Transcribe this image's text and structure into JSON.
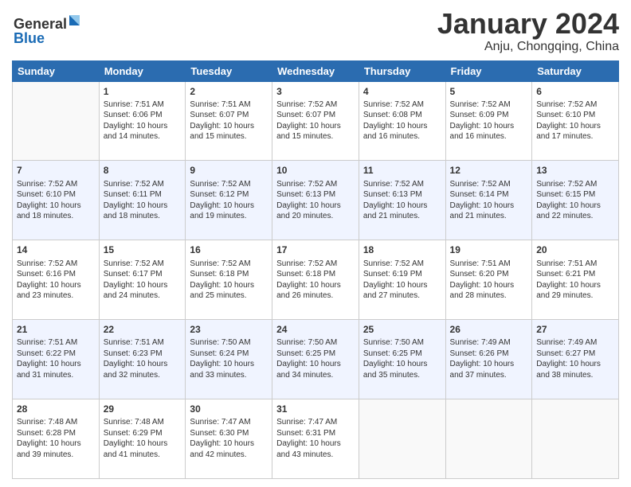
{
  "header": {
    "logo_general": "General",
    "logo_blue": "Blue",
    "month_title": "January 2024",
    "location": "Anju, Chongqing, China"
  },
  "weekdays": [
    "Sunday",
    "Monday",
    "Tuesday",
    "Wednesday",
    "Thursday",
    "Friday",
    "Saturday"
  ],
  "weeks": [
    [
      {
        "day": "",
        "sunrise": "",
        "sunset": "",
        "daylight": ""
      },
      {
        "day": "1",
        "sunrise": "Sunrise: 7:51 AM",
        "sunset": "Sunset: 6:06 PM",
        "daylight": "Daylight: 10 hours and 14 minutes."
      },
      {
        "day": "2",
        "sunrise": "Sunrise: 7:51 AM",
        "sunset": "Sunset: 6:07 PM",
        "daylight": "Daylight: 10 hours and 15 minutes."
      },
      {
        "day": "3",
        "sunrise": "Sunrise: 7:52 AM",
        "sunset": "Sunset: 6:07 PM",
        "daylight": "Daylight: 10 hours and 15 minutes."
      },
      {
        "day": "4",
        "sunrise": "Sunrise: 7:52 AM",
        "sunset": "Sunset: 6:08 PM",
        "daylight": "Daylight: 10 hours and 16 minutes."
      },
      {
        "day": "5",
        "sunrise": "Sunrise: 7:52 AM",
        "sunset": "Sunset: 6:09 PM",
        "daylight": "Daylight: 10 hours and 16 minutes."
      },
      {
        "day": "6",
        "sunrise": "Sunrise: 7:52 AM",
        "sunset": "Sunset: 6:10 PM",
        "daylight": "Daylight: 10 hours and 17 minutes."
      }
    ],
    [
      {
        "day": "7",
        "sunrise": "Sunrise: 7:52 AM",
        "sunset": "Sunset: 6:10 PM",
        "daylight": "Daylight: 10 hours and 18 minutes."
      },
      {
        "day": "8",
        "sunrise": "Sunrise: 7:52 AM",
        "sunset": "Sunset: 6:11 PM",
        "daylight": "Daylight: 10 hours and 18 minutes."
      },
      {
        "day": "9",
        "sunrise": "Sunrise: 7:52 AM",
        "sunset": "Sunset: 6:12 PM",
        "daylight": "Daylight: 10 hours and 19 minutes."
      },
      {
        "day": "10",
        "sunrise": "Sunrise: 7:52 AM",
        "sunset": "Sunset: 6:13 PM",
        "daylight": "Daylight: 10 hours and 20 minutes."
      },
      {
        "day": "11",
        "sunrise": "Sunrise: 7:52 AM",
        "sunset": "Sunset: 6:13 PM",
        "daylight": "Daylight: 10 hours and 21 minutes."
      },
      {
        "day": "12",
        "sunrise": "Sunrise: 7:52 AM",
        "sunset": "Sunset: 6:14 PM",
        "daylight": "Daylight: 10 hours and 21 minutes."
      },
      {
        "day": "13",
        "sunrise": "Sunrise: 7:52 AM",
        "sunset": "Sunset: 6:15 PM",
        "daylight": "Daylight: 10 hours and 22 minutes."
      }
    ],
    [
      {
        "day": "14",
        "sunrise": "Sunrise: 7:52 AM",
        "sunset": "Sunset: 6:16 PM",
        "daylight": "Daylight: 10 hours and 23 minutes."
      },
      {
        "day": "15",
        "sunrise": "Sunrise: 7:52 AM",
        "sunset": "Sunset: 6:17 PM",
        "daylight": "Daylight: 10 hours and 24 minutes."
      },
      {
        "day": "16",
        "sunrise": "Sunrise: 7:52 AM",
        "sunset": "Sunset: 6:18 PM",
        "daylight": "Daylight: 10 hours and 25 minutes."
      },
      {
        "day": "17",
        "sunrise": "Sunrise: 7:52 AM",
        "sunset": "Sunset: 6:18 PM",
        "daylight": "Daylight: 10 hours and 26 minutes."
      },
      {
        "day": "18",
        "sunrise": "Sunrise: 7:52 AM",
        "sunset": "Sunset: 6:19 PM",
        "daylight": "Daylight: 10 hours and 27 minutes."
      },
      {
        "day": "19",
        "sunrise": "Sunrise: 7:51 AM",
        "sunset": "Sunset: 6:20 PM",
        "daylight": "Daylight: 10 hours and 28 minutes."
      },
      {
        "day": "20",
        "sunrise": "Sunrise: 7:51 AM",
        "sunset": "Sunset: 6:21 PM",
        "daylight": "Daylight: 10 hours and 29 minutes."
      }
    ],
    [
      {
        "day": "21",
        "sunrise": "Sunrise: 7:51 AM",
        "sunset": "Sunset: 6:22 PM",
        "daylight": "Daylight: 10 hours and 31 minutes."
      },
      {
        "day": "22",
        "sunrise": "Sunrise: 7:51 AM",
        "sunset": "Sunset: 6:23 PM",
        "daylight": "Daylight: 10 hours and 32 minutes."
      },
      {
        "day": "23",
        "sunrise": "Sunrise: 7:50 AM",
        "sunset": "Sunset: 6:24 PM",
        "daylight": "Daylight: 10 hours and 33 minutes."
      },
      {
        "day": "24",
        "sunrise": "Sunrise: 7:50 AM",
        "sunset": "Sunset: 6:25 PM",
        "daylight": "Daylight: 10 hours and 34 minutes."
      },
      {
        "day": "25",
        "sunrise": "Sunrise: 7:50 AM",
        "sunset": "Sunset: 6:25 PM",
        "daylight": "Daylight: 10 hours and 35 minutes."
      },
      {
        "day": "26",
        "sunrise": "Sunrise: 7:49 AM",
        "sunset": "Sunset: 6:26 PM",
        "daylight": "Daylight: 10 hours and 37 minutes."
      },
      {
        "day": "27",
        "sunrise": "Sunrise: 7:49 AM",
        "sunset": "Sunset: 6:27 PM",
        "daylight": "Daylight: 10 hours and 38 minutes."
      }
    ],
    [
      {
        "day": "28",
        "sunrise": "Sunrise: 7:48 AM",
        "sunset": "Sunset: 6:28 PM",
        "daylight": "Daylight: 10 hours and 39 minutes."
      },
      {
        "day": "29",
        "sunrise": "Sunrise: 7:48 AM",
        "sunset": "Sunset: 6:29 PM",
        "daylight": "Daylight: 10 hours and 41 minutes."
      },
      {
        "day": "30",
        "sunrise": "Sunrise: 7:47 AM",
        "sunset": "Sunset: 6:30 PM",
        "daylight": "Daylight: 10 hours and 42 minutes."
      },
      {
        "day": "31",
        "sunrise": "Sunrise: 7:47 AM",
        "sunset": "Sunset: 6:31 PM",
        "daylight": "Daylight: 10 hours and 43 minutes."
      },
      {
        "day": "",
        "sunrise": "",
        "sunset": "",
        "daylight": ""
      },
      {
        "day": "",
        "sunrise": "",
        "sunset": "",
        "daylight": ""
      },
      {
        "day": "",
        "sunrise": "",
        "sunset": "",
        "daylight": ""
      }
    ]
  ]
}
